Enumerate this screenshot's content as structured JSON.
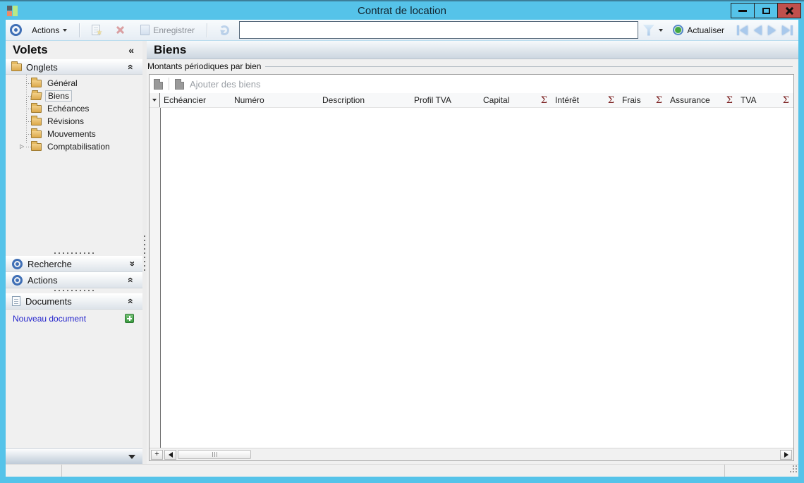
{
  "titlebar": {
    "title": "Contrat de location"
  },
  "toolbar": {
    "actions_label": "Actions",
    "enregistrer_label": "Enregistrer",
    "search_value": "",
    "actualiser_label": "Actualiser"
  },
  "sidebar": {
    "title": "Volets",
    "onglets": {
      "label": "Onglets",
      "items": [
        {
          "label": "Général"
        },
        {
          "label": "Biens"
        },
        {
          "label": "Echéances"
        },
        {
          "label": "Révisions"
        },
        {
          "label": "Mouvements"
        },
        {
          "label": "Comptabilisation"
        }
      ]
    },
    "sections": {
      "recherche": "Recherche",
      "actions": "Actions",
      "documents": "Documents",
      "new_document": "Nouveau document"
    }
  },
  "main": {
    "title": "Biens",
    "group_label": "Montants périodiques par bien",
    "grid": {
      "add_button": "Ajouter des biens",
      "plus_button": "+",
      "columns": [
        {
          "label": "Echéancier",
          "sum": ""
        },
        {
          "label": "Numéro",
          "sum": ""
        },
        {
          "label": "Description",
          "sum": ""
        },
        {
          "label": "Profil TVA",
          "sum": ""
        },
        {
          "label": "Capital",
          "sum": "Σ"
        },
        {
          "label": "Intérêt",
          "sum": "Σ"
        },
        {
          "label": "Frais",
          "sum": "Σ"
        },
        {
          "label": "Assurance",
          "sum": "Σ"
        },
        {
          "label": "TVA",
          "sum": "Σ"
        }
      ]
    }
  },
  "icons": {
    "collapse_left": "«",
    "chevron_double": "«",
    "tree_expander": "▷",
    "star": "★"
  },
  "colors": {
    "window_blue": "#55c3e9",
    "sigma_red": "#7b2020",
    "link_blue": "#2424cc",
    "close_red": "#c0504d"
  }
}
